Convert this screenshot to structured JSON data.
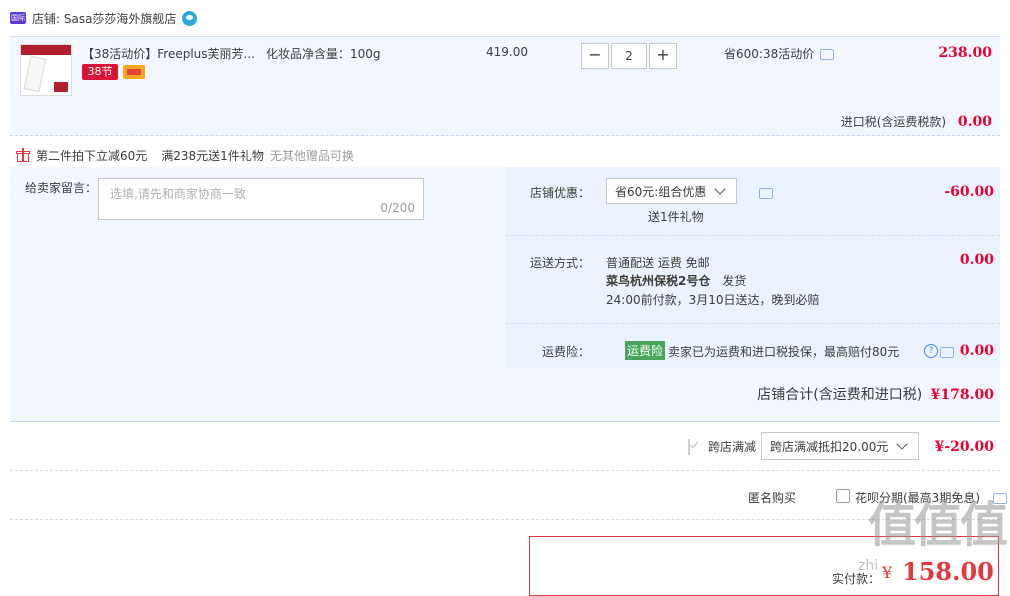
{
  "shop": {
    "badge": "国际",
    "label": "店铺: Sasa莎莎海外旗舰店"
  },
  "item": {
    "title": "【38活动价】Freeplus芙丽芳...",
    "badge_38": "38节",
    "spec": "化妆品净含量：100g",
    "unit_price": "419.00",
    "quantity": "2",
    "minus": "−",
    "plus": "+",
    "promo": "省600:38活动价",
    "total": "238.00",
    "tax_label": "进口税(含运费税款)",
    "tax_value": "0.00"
  },
  "gift": {
    "text1": "第二件拍下立减60元",
    "text2": "满238元送1件礼物",
    "text3": "无其他赠品可换"
  },
  "message": {
    "label": "给卖家留言：",
    "placeholder": "选填,请先和商家协商一致",
    "count": "0/200"
  },
  "discount": {
    "label": "店铺优惠：",
    "selected": "省60元:组合优惠",
    "sub": "送1件礼物",
    "value": "-60.00"
  },
  "shipping": {
    "label": "运送方式：",
    "line1": "普通配送 运费 免邮",
    "warehouse": "菜鸟杭州保税2号仓",
    "ship_word": "发货",
    "line3": "24:00前付款，3月10日送达，晚到必赔",
    "value": "0.00"
  },
  "insurance": {
    "label": "运费险：",
    "tag": "运费险",
    "text": "卖家已为运费和进口税投保，最高赔付80元",
    "value": "0.00"
  },
  "shop_total": {
    "label": "店铺合计(含运费和进口税)",
    "value": "¥178.00"
  },
  "cross_store": {
    "label": "跨店满减",
    "selected": "跨店满减抵扣20.00元",
    "value": "¥-20.00"
  },
  "options": {
    "anonymous": "匿名购买",
    "huabei": "花呗分期(最高3期免息)"
  },
  "payment": {
    "label": "实付款：",
    "yen": "¥",
    "amount": "158.00"
  },
  "watermark": {
    "main": "值值值",
    "sub": "zhi"
  },
  "colors": {
    "accent_red": "#e4393c",
    "panel_blue": "#f2f7ff",
    "check_blue": "#3b77d8"
  }
}
